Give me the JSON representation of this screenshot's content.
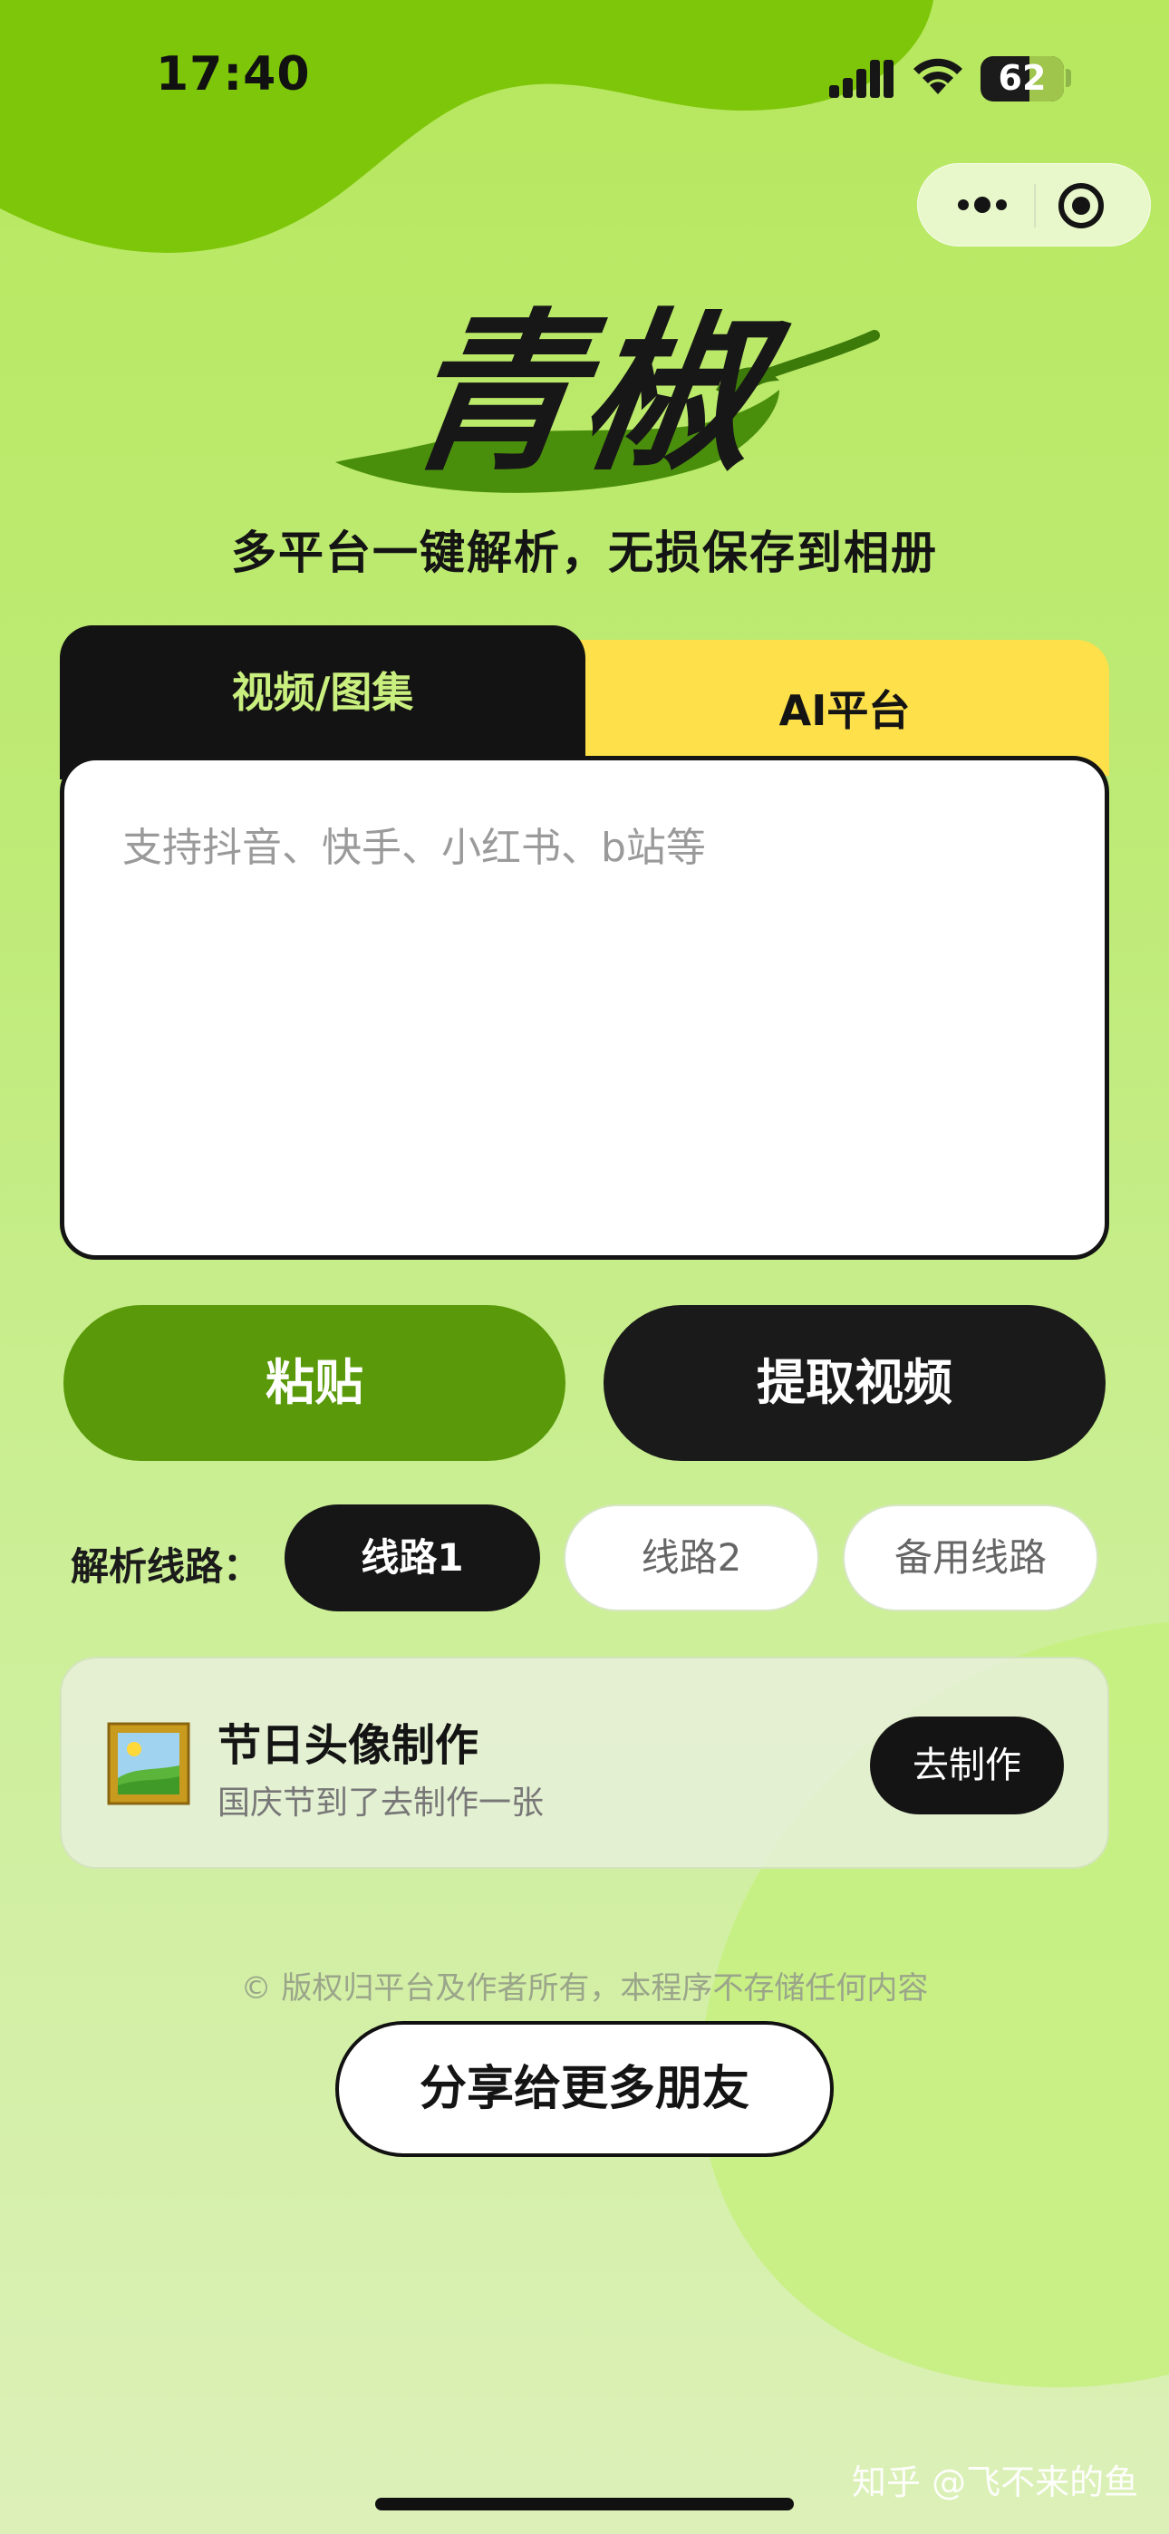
{
  "status_bar": {
    "time": "17:40",
    "battery_level": "62",
    "icons": [
      "signal-icon",
      "wifi-icon",
      "battery-icon"
    ]
  },
  "capsule": {
    "icons": [
      "more-icon",
      "close-miniprogram-icon"
    ]
  },
  "brand": {
    "logo_text": "青椒",
    "tagline": "多平台一键解析，无损保存到相册"
  },
  "tabs": [
    {
      "label": "视频/图集",
      "active": true
    },
    {
      "label": "AI平台",
      "active": false
    }
  ],
  "input": {
    "placeholder": "支持抖音、快手、小红书、b站等",
    "value": ""
  },
  "actions": {
    "paste_label": "粘贴",
    "extract_label": "提取视频"
  },
  "routes": {
    "label": "解析线路：",
    "options": [
      {
        "label": "线路1",
        "selected": true
      },
      {
        "label": "线路2",
        "selected": false
      },
      {
        "label": "备用线路",
        "selected": false
      }
    ]
  },
  "promo": {
    "icon": "framed-picture-icon",
    "title": "节日头像制作",
    "subtitle": "国庆节到了去制作一张",
    "button_label": "去制作"
  },
  "footer": {
    "copyright": "© 版权归平台及作者所有，本程序不存储任何内容",
    "share_label": "分享给更多朋友"
  },
  "watermark": "知乎 @飞不来的鱼",
  "colors": {
    "brand_green": "#5a9a0a",
    "accent_yellow": "#fde04a",
    "dark": "#141414",
    "light_green_text": "#c9ef7e"
  }
}
